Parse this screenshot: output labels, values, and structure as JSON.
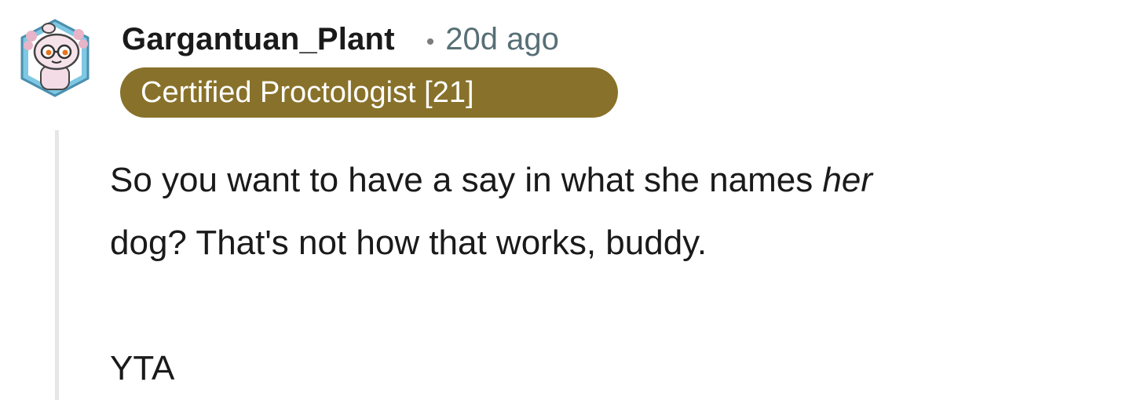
{
  "comment": {
    "username": "Gargantuan_Plant",
    "separator": "•",
    "timestamp": "20d ago",
    "flair": "Certified Proctologist [21]",
    "body": {
      "line1_before_emphasis": "So you want to have a say in what she names ",
      "emphasis": "her",
      "line2": "dog? That's not how that works, buddy.",
      "verdict": "YTA"
    }
  },
  "colors": {
    "flair_background": "#88712a",
    "flair_text": "#ffffff",
    "timestamp": "#576f76",
    "thread_line": "#e4e6e7"
  },
  "icons": {
    "avatar": "axolotl-snoo-avatar-with-glasses"
  }
}
